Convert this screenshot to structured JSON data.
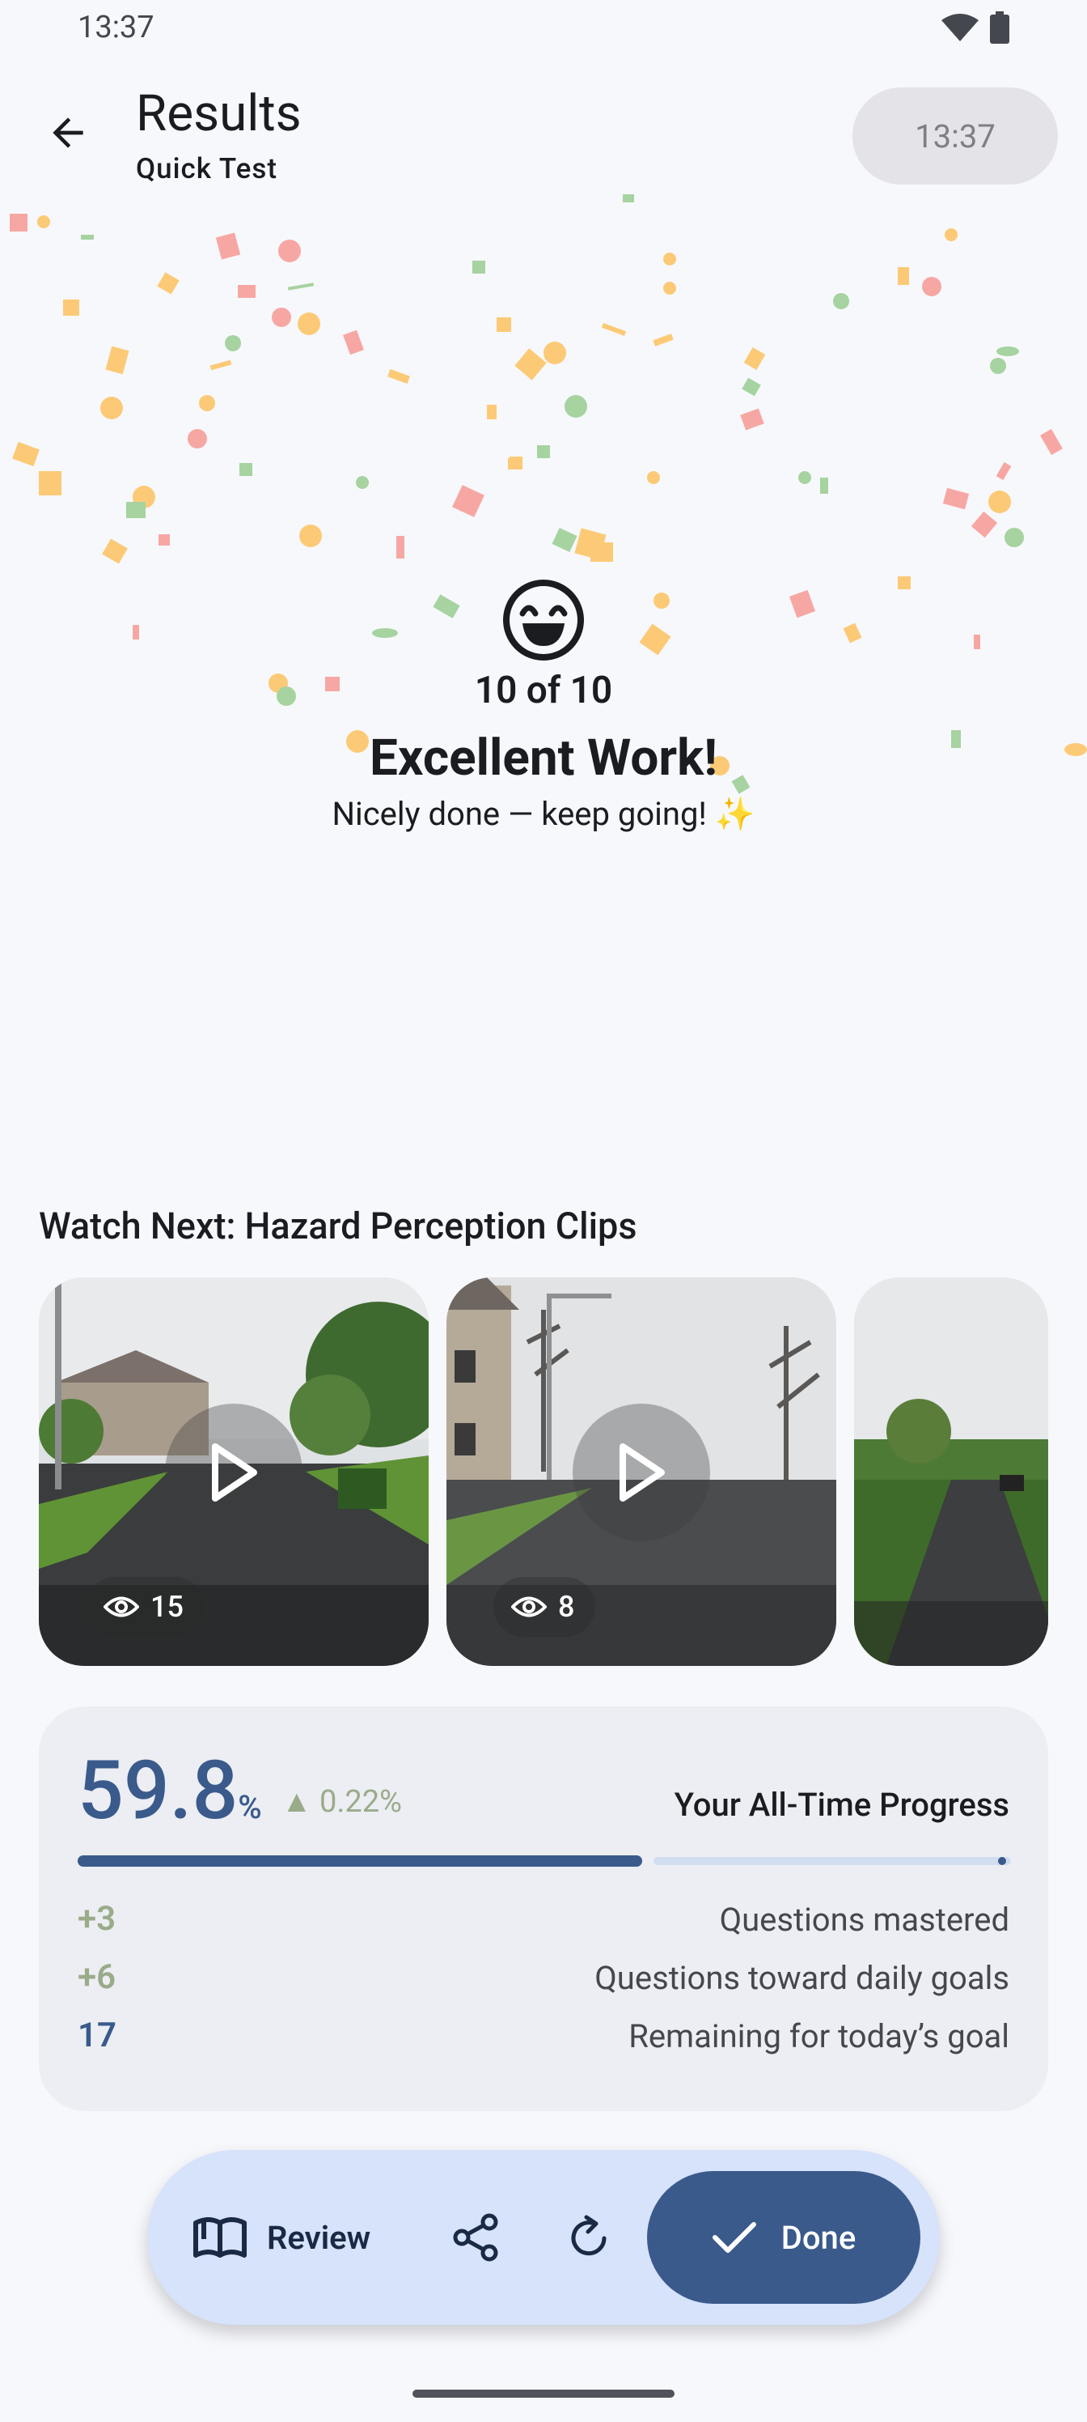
{
  "status_bar": {
    "time": "13:37"
  },
  "header": {
    "title": "Results",
    "subtitle": "Quick Test",
    "timer": "13:37"
  },
  "result": {
    "score": "10 of 10",
    "headline": "Excellent Work!",
    "tagline": "Nicely done — keep going! ✨"
  },
  "watch_next": {
    "title": "Watch Next: Hazard Perception Clips",
    "clips": [
      {
        "views": "15"
      },
      {
        "views": "8"
      },
      {
        "views": ""
      }
    ]
  },
  "progress": {
    "percent": "59.8",
    "percent_sign": "%",
    "delta": "▲ 0.22%",
    "label": "Your All-Time Progress",
    "fill_fraction": 0.598,
    "stats": [
      {
        "value": "+3",
        "label": "Questions mastered"
      },
      {
        "value": "+6",
        "label": "Questions toward daily goals"
      },
      {
        "value": "17",
        "label": "Remaining for today’s goal"
      }
    ]
  },
  "toolbar": {
    "review_label": "Review",
    "done_label": "Done"
  },
  "colors": {
    "accent": "#3a5a8c",
    "positive": "#9aab8a",
    "toolbar_bg": "#d7e2fb"
  }
}
